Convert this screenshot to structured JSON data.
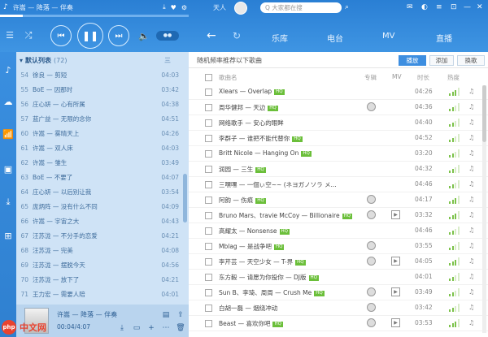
{
  "player": {
    "top_line": "许嵩 — 降落 — 伴奏",
    "progress": 0.12,
    "volume_label": "●●",
    "icons": [
      "download-icon",
      "heart-icon",
      "speaker-icon"
    ]
  },
  "playlist": {
    "header_title": "默认列表",
    "header_count": "(72)",
    "header_sort": "三",
    "items": [
      {
        "num": "54",
        "title": "徐良 — 剪短",
        "dur": "04:03"
      },
      {
        "num": "55",
        "title": "BoE — 因那时",
        "dur": "03:42"
      },
      {
        "num": "56",
        "title": "庄心妍 — 心有所属",
        "dur": "04:38"
      },
      {
        "num": "57",
        "title": "蓝广益 — 无限的念你",
        "dur": "04:51"
      },
      {
        "num": "60",
        "title": "许嵩 — 雾晴天上",
        "dur": "04:26"
      },
      {
        "num": "61",
        "title": "许嵩 — 双人床",
        "dur": "04:03"
      },
      {
        "num": "62",
        "title": "许嵩 — 雏生",
        "dur": "03:49"
      },
      {
        "num": "63",
        "title": "BoE — 不要了",
        "dur": "04:07"
      },
      {
        "num": "64",
        "title": "庄心妍 — 以后别让我",
        "dur": "03:54"
      },
      {
        "num": "65",
        "title": "庞炳阵 — 没有什么不同",
        "dur": "04:09"
      },
      {
        "num": "66",
        "title": "许嵩 — 宇宙之大",
        "dur": "04:43"
      },
      {
        "num": "67",
        "title": "汪苏泷 — 不分手的恋爱",
        "dur": "04:21"
      },
      {
        "num": "68",
        "title": "汪苏泷 — 完美",
        "dur": "04:08"
      },
      {
        "num": "69",
        "title": "汪苏泷 — 摆脱今天",
        "dur": "04:56"
      },
      {
        "num": "70",
        "title": "汪苏泷 — 放下了",
        "dur": "04:21"
      },
      {
        "num": "71",
        "title": "王力宏 — 需要人陪",
        "dur": "04:01"
      }
    ]
  },
  "now_playing": {
    "title": "许嵩 — 降落 — 伴奏",
    "time": "00:04/4:07"
  },
  "topbar": {
    "user": "天人",
    "search_placeholder": "Q 大家都在搜"
  },
  "nav": {
    "tabs": [
      "乐库",
      "电台",
      "MV",
      "直播"
    ]
  },
  "recommend": {
    "text": "随机频率推荐以下歌曲",
    "play_all": "播放",
    "add": "添加",
    "refresh": "换歌"
  },
  "columns": {
    "song": "歌曲名",
    "album": "专辑",
    "mv": "MV",
    "duration": "时长",
    "hot": "热度"
  },
  "songs": [
    {
      "title": "Xlears — Overlap",
      "badge": "HQ",
      "album": false,
      "mv": false,
      "dur": "04:26",
      "hot": 0.7
    },
    {
      "title": "周华健邦 — 天边",
      "badge": "HQ",
      "album": true,
      "mv": false,
      "dur": "04:36",
      "hot": 0.6
    },
    {
      "title": "网络歌手 — 安心的眼眸",
      "badge": "",
      "album": false,
      "mv": false,
      "dur": "04:40",
      "hot": 0.6
    },
    {
      "title": "李群子 — 谁把不能代替你",
      "badge": "HQ",
      "album": false,
      "mv": false,
      "dur": "04:52",
      "hot": 0.5
    },
    {
      "title": "Britt Nicole — Hanging On",
      "badge": "HQ",
      "album": false,
      "mv": false,
      "dur": "03:20",
      "hot": 0.6
    },
    {
      "title": "润园 — 三生",
      "badge": "HQ",
      "album": false,
      "mv": false,
      "dur": "04:32",
      "hot": 0.5
    },
    {
      "title": "三嘿嘿 — 一個ぃ空~~ (ネヨガノソラ メ...",
      "badge": "",
      "album": false,
      "mv": false,
      "dur": "04:46",
      "hot": 0.6
    },
    {
      "title": "阿韵 — 伤痕",
      "badge": "HQ",
      "album": true,
      "mv": false,
      "dur": "04:17",
      "hot": 0.7
    },
    {
      "title": "Bruno Mars、travie McCoy — Billionaire",
      "badge": "HQ",
      "album": true,
      "mv": true,
      "dur": "03:32",
      "hot": 0.8
    },
    {
      "title": "高耀太 — Nonsense",
      "badge": "HQ",
      "album": false,
      "mv": false,
      "dur": "04:46",
      "hot": 0.5
    },
    {
      "title": "Mblag — 是战争吧",
      "badge": "HQ",
      "album": true,
      "mv": false,
      "dur": "03:55",
      "hot": 0.6
    },
    {
      "title": "李芹芸 — 天空少女 — T-界",
      "badge": "HQ",
      "album": true,
      "mv": true,
      "dur": "04:05",
      "hot": 0.7
    },
    {
      "title": "东方毅 — 请愿为你投你 — DJ版",
      "badge": "HQ",
      "album": false,
      "mv": false,
      "dur": "04:01",
      "hot": 0.5
    },
    {
      "title": "Sun B、李琦、周周 — Crush Me",
      "badge": "HQ",
      "album": true,
      "mv": true,
      "dur": "03:49",
      "hot": 0.6
    },
    {
      "title": "白胡一磊 — 烟绕冲动",
      "badge": "",
      "album": true,
      "mv": false,
      "dur": "03:42",
      "hot": 0.5
    },
    {
      "title": "Beast — 喜欢你吧",
      "badge": "HQ",
      "album": true,
      "mv": true,
      "dur": "03:53",
      "hot": 0.7
    }
  ],
  "watermark": {
    "logo": "php",
    "text": "中文网"
  },
  "colors": {
    "accent": "#3d8ee0",
    "hot_bar": "#7cc24a",
    "badge": "#6bbf3a"
  }
}
